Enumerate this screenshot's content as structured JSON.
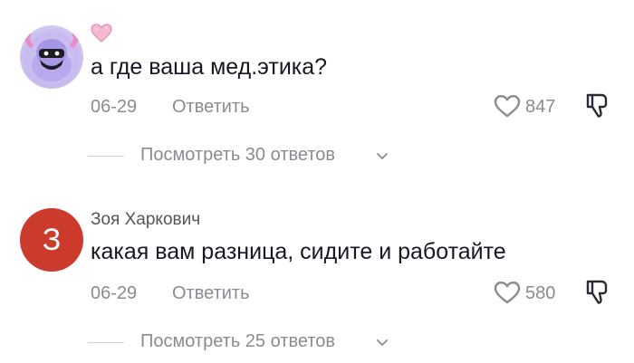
{
  "comments": [
    {
      "author": "",
      "avatar_type": "image",
      "has_heart_badge": true,
      "text": "а где ваша мед.этика?",
      "date": "06-29",
      "reply_label": "Ответить",
      "likes": "847",
      "view_replies": "Посмотреть 30 ответов"
    },
    {
      "author": "Зоя Харкович",
      "avatar_type": "letter",
      "avatar_letter": "З",
      "avatar_color": "#cc3a2b",
      "text": "какая вам разница, сидите и работайте",
      "date": "06-29",
      "reply_label": "Ответить",
      "likes": "580",
      "view_replies": "Посмотреть 25 ответов"
    }
  ],
  "icons": {
    "heart_badge": "pink-heart-icon",
    "like": "heart-outline-icon",
    "dislike": "thumbs-down-icon",
    "chevron": "chevron-down-icon"
  },
  "colors": {
    "text_primary": "#161823",
    "text_secondary": "#8a8b91",
    "heart_badge": "#f3a6c8"
  }
}
